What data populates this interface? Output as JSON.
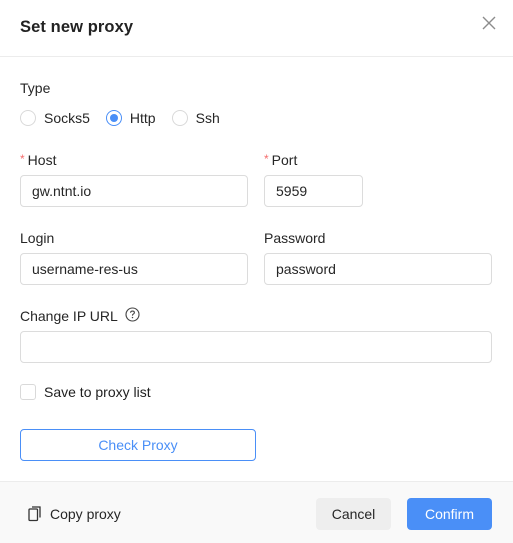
{
  "dialog": {
    "title": "Set new proxy",
    "close_icon": "close-icon"
  },
  "type": {
    "label": "Type",
    "options": [
      {
        "label": "Socks5",
        "checked": false
      },
      {
        "label": "Http",
        "checked": true
      },
      {
        "label": "Ssh",
        "checked": false
      }
    ]
  },
  "host": {
    "label": "Host",
    "required_mark": "*",
    "value": "gw.ntnt.io",
    "placeholder": ""
  },
  "port": {
    "label": "Port",
    "required_mark": "*",
    "value": "5959",
    "placeholder": ""
  },
  "login": {
    "label": "Login",
    "value": "username-res-us",
    "placeholder": ""
  },
  "password": {
    "label": "Password",
    "value": "password",
    "placeholder": ""
  },
  "change_ip_url": {
    "label": "Change IP URL",
    "help_icon": "question-circle-icon",
    "value": "",
    "placeholder": ""
  },
  "save_to_list": {
    "label": "Save to proxy list",
    "checked": false
  },
  "check_proxy_button": "Check Proxy",
  "footer": {
    "copy_label": "Copy proxy",
    "copy_icon": "copy-icon",
    "cancel_label": "Cancel",
    "confirm_label": "Confirm"
  },
  "colors": {
    "accent": "#4a8ff7",
    "required": "#f56c6c",
    "footer_bg": "#f9f9f9",
    "cancel_bg": "#eeeeee"
  }
}
